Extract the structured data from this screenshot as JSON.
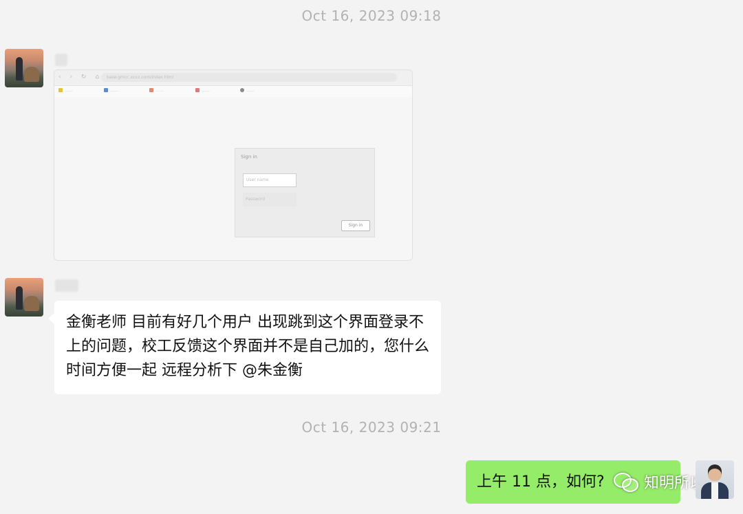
{
  "chat": {
    "timestamp_1": "Oct 16, 2023 09:18",
    "timestamp_2": "Oct 16, 2023 09:21"
  },
  "screenshot": {
    "address": "base.gmcc.xxxx.com/index.html",
    "bookmarks": [
      "……",
      "……",
      "……",
      "……",
      "……"
    ],
    "login_title": "Sign in",
    "username_placeholder": "User name",
    "password_placeholder": "Password",
    "signin_label": "Sign in",
    "bookmark_colors": [
      "#e6c23a",
      "#5b8dd6",
      "#e08a6a",
      "#e07a7a",
      "#8a8a8a"
    ]
  },
  "messages": {
    "incoming_text": "金衡老师 目前有好几个用户 出现跳到这个界面登录不上的问题，校工反馈这个界面并不是自己加的，您什么时间方便一起 远程分析下 @朱金衡",
    "outgoing_text": "上午 11 点，如何?"
  },
  "watermark": {
    "text": "知明所以"
  },
  "colors": {
    "background": "#f3f3f3",
    "incoming_bubble": "#ffffff",
    "outgoing_bubble": "#95ec69",
    "timestamp": "#b2b2b2"
  }
}
